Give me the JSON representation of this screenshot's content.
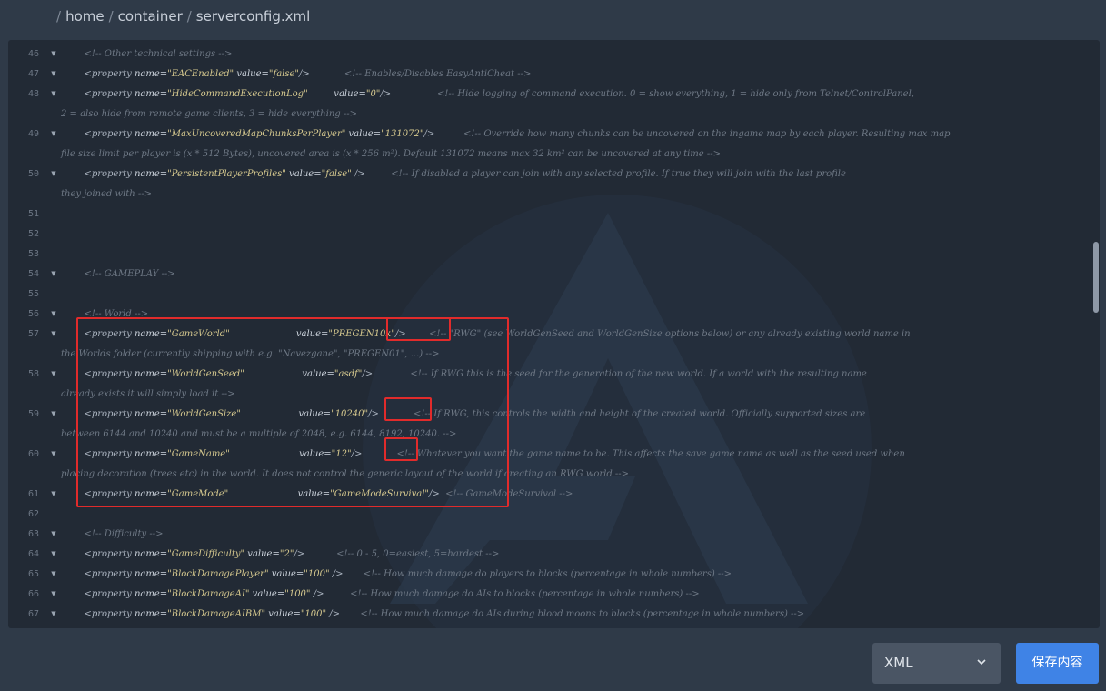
{
  "breadcrumb": {
    "items": [
      "home",
      "container",
      "serverconfig.xml"
    ]
  },
  "editor": {
    "lines": [
      {
        "n": "46",
        "fold": true,
        "indent": "        ",
        "parts": [
          {
            "t": "<!-- Other technical settings -->",
            "k": "comment"
          }
        ]
      },
      {
        "n": "47",
        "fold": true,
        "indent": "        ",
        "parts": [
          {
            "t": "<property ",
            "k": "tag"
          },
          {
            "t": "name=",
            "k": "attr"
          },
          {
            "t": "\"EACEnabled\"",
            "k": "val"
          },
          {
            "t": " value=",
            "k": "attr"
          },
          {
            "t": "\"false\"",
            "k": "val"
          },
          {
            "t": "/>",
            "k": "tag"
          },
          {
            "t": "            <!-- Enables/Disables EasyAntiCheat -->",
            "k": "comment"
          }
        ]
      },
      {
        "n": "48",
        "fold": true,
        "indent": "        ",
        "parts": [
          {
            "t": "<property ",
            "k": "tag"
          },
          {
            "t": "name=",
            "k": "attr"
          },
          {
            "t": "\"HideCommandExecutionLog\"",
            "k": "val"
          },
          {
            "t": "         value=",
            "k": "attr"
          },
          {
            "t": "\"0\"",
            "k": "val"
          },
          {
            "t": "/>",
            "k": "tag"
          },
          {
            "t": "                <!-- Hide logging of command execution. 0 = show everything, 1 = hide only from Telnet/ControlPanel,",
            "k": "comment"
          }
        ],
        "wrap": "2 = also hide from remote game clients, 3 = hide everything -->"
      },
      {
        "n": "49",
        "fold": true,
        "indent": "        ",
        "parts": [
          {
            "t": "<property ",
            "k": "tag"
          },
          {
            "t": "name=",
            "k": "attr"
          },
          {
            "t": "\"MaxUncoveredMapChunksPerPlayer\"",
            "k": "val"
          },
          {
            "t": " value=",
            "k": "attr"
          },
          {
            "t": "\"131072\"",
            "k": "val"
          },
          {
            "t": "/>",
            "k": "tag"
          },
          {
            "t": "          <!-- Override how many chunks can be uncovered on the ingame map by each player. Resulting max map",
            "k": "comment"
          }
        ],
        "wrap": "file size limit per player is (x * 512 Bytes), uncovered area is (x * 256 m²). Default 131072 means max 32 km² can be uncovered at any time -->"
      },
      {
        "n": "50",
        "fold": true,
        "indent": "        ",
        "parts": [
          {
            "t": "<property ",
            "k": "tag"
          },
          {
            "t": "name=",
            "k": "attr"
          },
          {
            "t": "\"PersistentPlayerProfiles\"",
            "k": "val"
          },
          {
            "t": " value=",
            "k": "attr"
          },
          {
            "t": "\"false\"",
            "k": "val"
          },
          {
            "t": " />",
            "k": "tag"
          },
          {
            "t": "         <!-- If disabled a player can join with any selected profile. If true they will join with the last profile",
            "k": "comment"
          }
        ],
        "wrap": "they joined with -->"
      },
      {
        "n": "51",
        "fold": false,
        "indent": "",
        "parts": []
      },
      {
        "n": "52",
        "fold": false,
        "indent": "",
        "parts": []
      },
      {
        "n": "53",
        "fold": false,
        "indent": "",
        "parts": []
      },
      {
        "n": "54",
        "fold": true,
        "indent": "        ",
        "parts": [
          {
            "t": "<!-- GAMEPLAY -->",
            "k": "comment"
          }
        ]
      },
      {
        "n": "55",
        "fold": false,
        "indent": "",
        "parts": []
      },
      {
        "n": "56",
        "fold": true,
        "indent": "        ",
        "parts": [
          {
            "t": "<!-- World -->",
            "k": "comment"
          }
        ]
      },
      {
        "n": "57",
        "fold": true,
        "indent": "        ",
        "parts": [
          {
            "t": "<property ",
            "k": "tag"
          },
          {
            "t": "name=",
            "k": "attr"
          },
          {
            "t": "\"GameWorld\"",
            "k": "val"
          },
          {
            "t": "                       value=",
            "k": "attr"
          },
          {
            "t": "\"PREGEN10k\"",
            "k": "val"
          },
          {
            "t": "/>",
            "k": "tag"
          },
          {
            "t": "        <!-- \"RWG\" (see WorldGenSeed and WorldGenSize options below) or any already existing world name in",
            "k": "comment"
          }
        ],
        "wrap": "the Worlds folder (currently shipping with e.g. \"Navezgane\", \"PREGEN01\", ...) -->"
      },
      {
        "n": "58",
        "fold": true,
        "indent": "        ",
        "parts": [
          {
            "t": "<property ",
            "k": "tag"
          },
          {
            "t": "name=",
            "k": "attr"
          },
          {
            "t": "\"WorldGenSeed\"",
            "k": "val"
          },
          {
            "t": "                    value=",
            "k": "attr"
          },
          {
            "t": "\"asdf\"",
            "k": "val"
          },
          {
            "t": "/>",
            "k": "tag"
          },
          {
            "t": "             <!-- If RWG this is the seed for the generation of the new world. If a world with the resulting name",
            "k": "comment"
          }
        ],
        "wrap": "already exists it will simply load it -->"
      },
      {
        "n": "59",
        "fold": true,
        "indent": "        ",
        "parts": [
          {
            "t": "<property ",
            "k": "tag"
          },
          {
            "t": "name=",
            "k": "attr"
          },
          {
            "t": "\"WorldGenSize\"",
            "k": "val"
          },
          {
            "t": "                    value=",
            "k": "attr"
          },
          {
            "t": "\"10240\"",
            "k": "val"
          },
          {
            "t": "/>",
            "k": "tag"
          },
          {
            "t": "            <!-- If RWG, this controls the width and height of the created world. Officially supported sizes are",
            "k": "comment"
          }
        ],
        "wrap": "between 6144 and 10240 and must be a multiple of 2048, e.g. 6144, 8192, 10240. -->"
      },
      {
        "n": "60",
        "fold": true,
        "indent": "        ",
        "parts": [
          {
            "t": "<property ",
            "k": "tag"
          },
          {
            "t": "name=",
            "k": "attr"
          },
          {
            "t": "\"GameName\"",
            "k": "val"
          },
          {
            "t": "                        value=",
            "k": "attr"
          },
          {
            "t": "\"12\"",
            "k": "val"
          },
          {
            "t": "/>",
            "k": "tag"
          },
          {
            "t": "            <!-- Whatever you want the game name to be. This affects the save game name as well as the seed used when",
            "k": "comment"
          }
        ],
        "wrap": "placing decoration (trees etc) in the world. It does not control the generic layout of the world if creating an RWG world -->"
      },
      {
        "n": "61",
        "fold": true,
        "indent": "        ",
        "parts": [
          {
            "t": "<property ",
            "k": "tag"
          },
          {
            "t": "name=",
            "k": "attr"
          },
          {
            "t": "\"GameMode\"",
            "k": "val"
          },
          {
            "t": "                        value=",
            "k": "attr"
          },
          {
            "t": "\"GameModeSurvival\"",
            "k": "val"
          },
          {
            "t": "/>",
            "k": "tag"
          },
          {
            "t": "  <!-- GameModeSurvival -->",
            "k": "comment"
          }
        ]
      },
      {
        "n": "62",
        "fold": false,
        "indent": "",
        "parts": []
      },
      {
        "n": "63",
        "fold": true,
        "indent": "        ",
        "parts": [
          {
            "t": "<!-- Difficulty -->",
            "k": "comment"
          }
        ]
      },
      {
        "n": "64",
        "fold": true,
        "indent": "        ",
        "parts": [
          {
            "t": "<property ",
            "k": "tag"
          },
          {
            "t": "name=",
            "k": "attr"
          },
          {
            "t": "\"GameDifficulty\"",
            "k": "val"
          },
          {
            "t": " value=",
            "k": "attr"
          },
          {
            "t": "\"2\"",
            "k": "val"
          },
          {
            "t": "/>",
            "k": "tag"
          },
          {
            "t": "           <!-- 0 - 5, 0=easiest, 5=hardest -->",
            "k": "comment"
          }
        ]
      },
      {
        "n": "65",
        "fold": true,
        "indent": "        ",
        "parts": [
          {
            "t": "<property ",
            "k": "tag"
          },
          {
            "t": "name=",
            "k": "attr"
          },
          {
            "t": "\"BlockDamagePlayer\"",
            "k": "val"
          },
          {
            "t": " value=",
            "k": "attr"
          },
          {
            "t": "\"100\"",
            "k": "val"
          },
          {
            "t": " />",
            "k": "tag"
          },
          {
            "t": "       <!-- How much damage do players to blocks (percentage in whole numbers) -->",
            "k": "comment"
          }
        ]
      },
      {
        "n": "66",
        "fold": true,
        "indent": "        ",
        "parts": [
          {
            "t": "<property ",
            "k": "tag"
          },
          {
            "t": "name=",
            "k": "attr"
          },
          {
            "t": "\"BlockDamageAI\"",
            "k": "val"
          },
          {
            "t": " value=",
            "k": "attr"
          },
          {
            "t": "\"100\"",
            "k": "val"
          },
          {
            "t": " />",
            "k": "tag"
          },
          {
            "t": "         <!-- How much damage do AIs to blocks (percentage in whole numbers) -->",
            "k": "comment"
          }
        ]
      },
      {
        "n": "67",
        "fold": true,
        "indent": "        ",
        "parts": [
          {
            "t": "<property ",
            "k": "tag"
          },
          {
            "t": "name=",
            "k": "attr"
          },
          {
            "t": "\"BlockDamageAIBM\"",
            "k": "val"
          },
          {
            "t": " value=",
            "k": "attr"
          },
          {
            "t": "\"100\"",
            "k": "val"
          },
          {
            "t": " />",
            "k": "tag"
          },
          {
            "t": "       <!-- How much damage do AIs during blood moons to blocks (percentage in whole numbers) -->",
            "k": "comment"
          }
        ]
      }
    ]
  },
  "language_select": {
    "value": "XML"
  },
  "save_button": {
    "label": "保存内容"
  },
  "icons": {
    "fold": "triangle-down-icon",
    "dropdown": "chevron-down-icon"
  },
  "colors": {
    "highlight": "#e12b2b",
    "accent": "#3f83e6"
  }
}
